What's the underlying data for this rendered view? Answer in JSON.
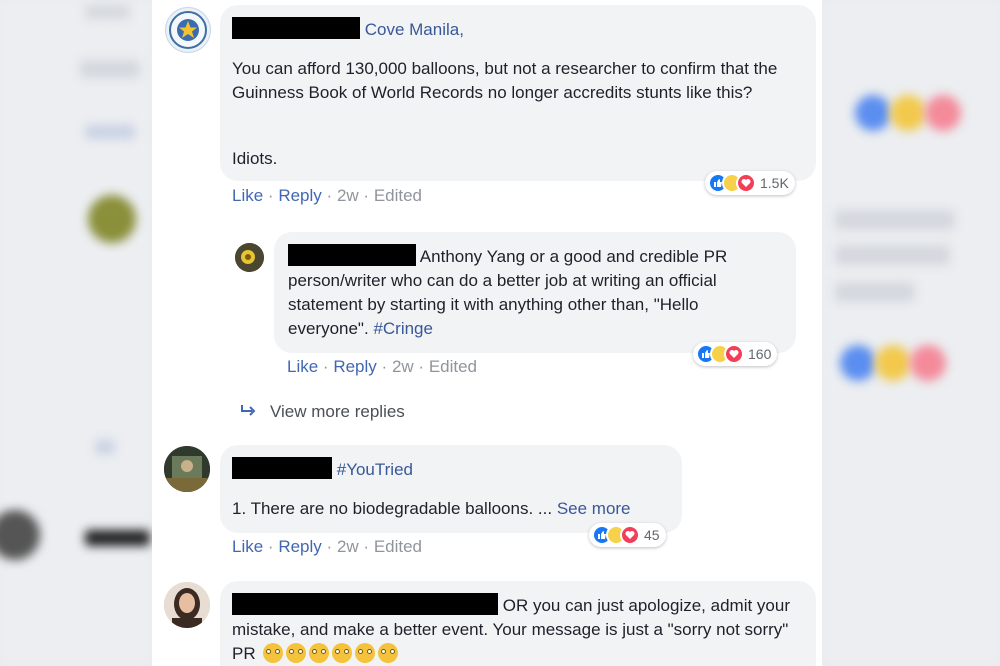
{
  "comments": [
    {
      "author_tag": "Cove Manila,",
      "paragraphs": [
        "You can afford 130,000 balloons, but not a researcher to confirm that the Guinness Book of World Records no longer accredits stunts like this?",
        "Idiots."
      ],
      "actions": {
        "like": "Like",
        "reply": "Reply",
        "time": "2w",
        "edited": "Edited"
      },
      "reaction_count": "1.5K"
    },
    {
      "text": "Anthony Yang or a good and credible PR person/writer who can do a better job at writing an official statement by starting it with anything other than, \"Hello everyone\".",
      "hashtag": "#Cringe",
      "actions": {
        "like": "Like",
        "reply": "Reply",
        "time": "2w",
        "edited": "Edited"
      },
      "reaction_count": "160"
    },
    {
      "hashtag": "#YouTried",
      "text": "1. There are no biodegradable balloons. ...",
      "see_more": "See more",
      "actions": {
        "like": "Like",
        "reply": "Reply",
        "time": "2w",
        "edited": "Edited"
      },
      "reaction_count": "45"
    },
    {
      "text": "OR you can just apologize, admit your mistake, and make a better event. Your message is just a \"sorry not sorry\" PR",
      "emoji_count": 6,
      "emoji": "face-with-rolling-eyes"
    }
  ],
  "view_more_replies": "View more replies",
  "sep": "·",
  "colors": {
    "link": "#385898",
    "action_link": "#4267b2",
    "bubble": "#f2f3f5",
    "like": "#1877f2",
    "love": "#f33e58",
    "haha": "#f7d14b"
  }
}
